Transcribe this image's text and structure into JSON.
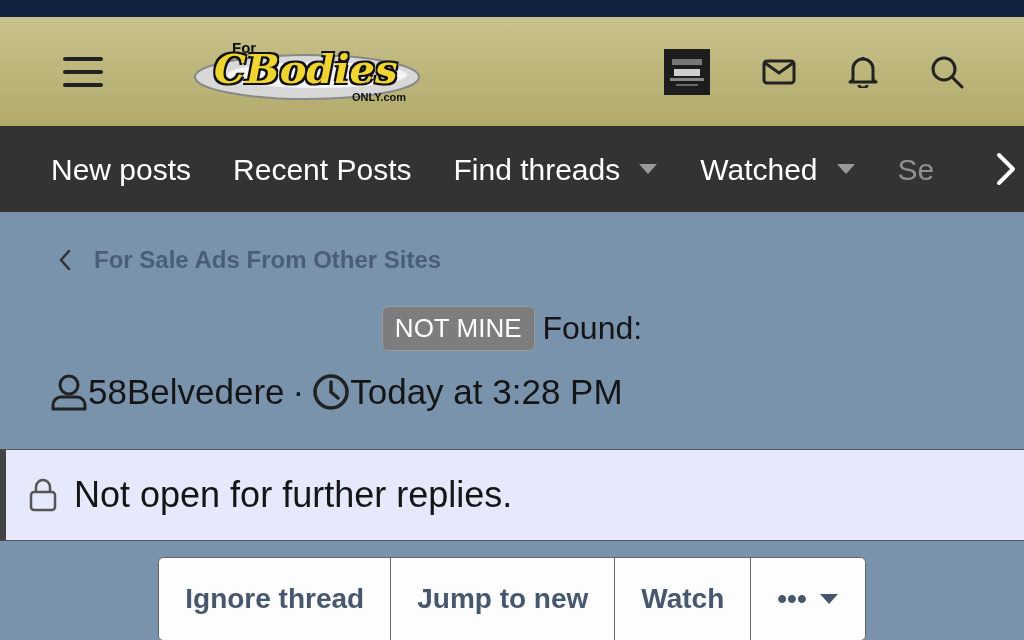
{
  "logo": {
    "top": "For",
    "main": "CBodies",
    "bottom": "ONLY.com"
  },
  "nav": [
    {
      "label": "New posts",
      "dropdown": false,
      "faded": false
    },
    {
      "label": "Recent Posts",
      "dropdown": false,
      "faded": false
    },
    {
      "label": "Find threads",
      "dropdown": true,
      "faded": false
    },
    {
      "label": "Watched",
      "dropdown": true,
      "faded": false
    },
    {
      "label": "Se",
      "dropdown": false,
      "faded": true
    }
  ],
  "breadcrumb": "For Sale Ads From Other Sites",
  "thread": {
    "prefix": "NOT MINE",
    "title": "Found:",
    "author": "58Belvedere",
    "separator": "·",
    "time": "Today at 3:28 PM"
  },
  "notice": "Not open for further replies.",
  "buttons": [
    {
      "label": "Ignore thread",
      "dropdown": false
    },
    {
      "label": "Jump to new",
      "dropdown": false
    },
    {
      "label": "Watch",
      "dropdown": false
    },
    {
      "label": "•••",
      "dropdown": true
    }
  ]
}
